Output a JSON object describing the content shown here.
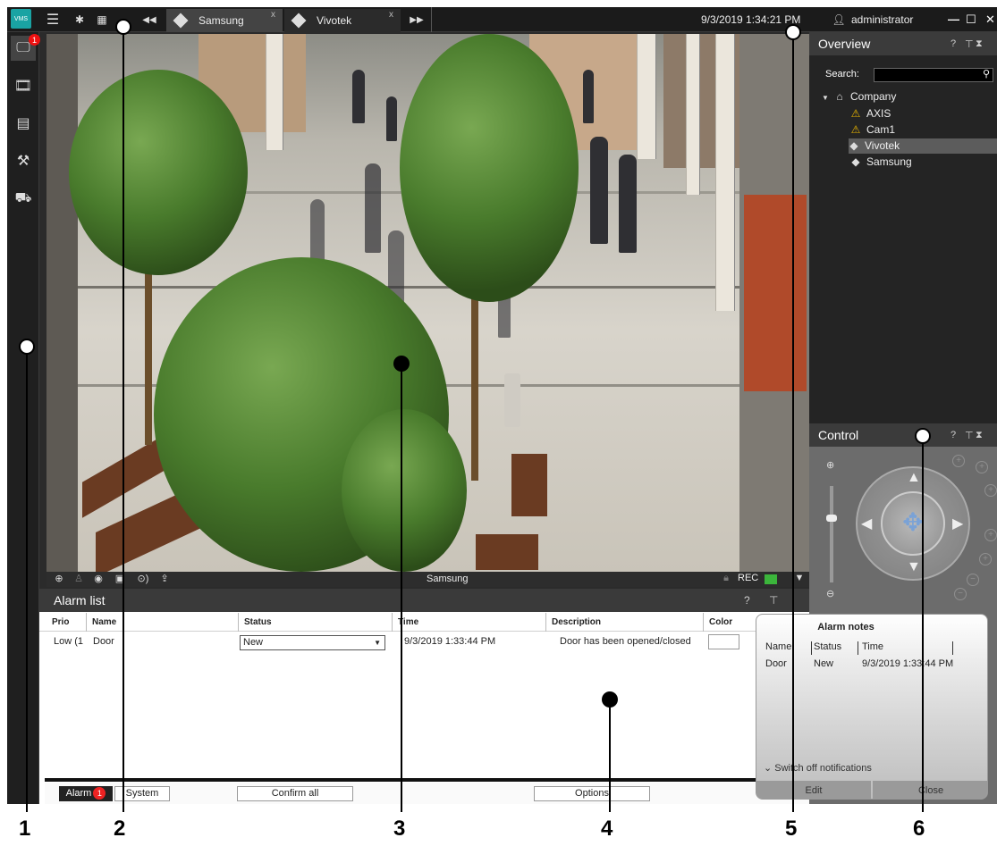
{
  "topbar": {
    "logo_text": "VMS",
    "tabs": [
      {
        "label": "Samsung",
        "close": "x",
        "active": true
      },
      {
        "label": "Vivotek",
        "close": "x",
        "active": false
      }
    ],
    "datetime": "9/3/2019 1:34:21 PM",
    "user": "administrator"
  },
  "sidebar": {
    "badge": "1",
    "items": [
      "live-view",
      "playback",
      "reports",
      "settings",
      "vehicle"
    ]
  },
  "video": {
    "camera_name": "Samsung",
    "rec_label": "REC"
  },
  "alarm_list": {
    "title": "Alarm list",
    "columns": [
      "Prio",
      "Name",
      "Status",
      "Time",
      "Description",
      "Color"
    ],
    "rows": [
      {
        "prio": "Low (1",
        "name": "Door",
        "status": "New",
        "time": "9/3/2019 1:33:44 PM",
        "description": "Door has been opened/closed"
      }
    ],
    "footer": {
      "alarm_tab": "Alarm",
      "alarm_badge": "1",
      "system_tab": "System",
      "confirm_all": "Confirm all",
      "options": "Options"
    }
  },
  "overview": {
    "title": "Overview",
    "search_label": "Search:",
    "tree": [
      {
        "label": "Company",
        "level": 0
      },
      {
        "label": "AXIS",
        "level": 1
      },
      {
        "label": "Cam1",
        "level": 1
      },
      {
        "label": "Vivotek",
        "level": 1,
        "selected": true
      },
      {
        "label": "Samsung",
        "level": 1
      }
    ]
  },
  "control": {
    "title": "Control"
  },
  "alarm_notes": {
    "title": "Alarm notes",
    "columns": [
      "Name",
      "Status",
      "Time"
    ],
    "row": {
      "name": "Door",
      "status": "New",
      "time": "9/3/2019 1:33:44 PM"
    },
    "switch_off": "Switch off notifications",
    "edit": "Edit",
    "close": "Close"
  },
  "callouts": [
    "1",
    "2",
    "3",
    "4",
    "5",
    "6"
  ],
  "colors": {
    "accent": "#1aa3a3",
    "badge": "#e11111",
    "rec_indicator": "#3bb53b"
  }
}
